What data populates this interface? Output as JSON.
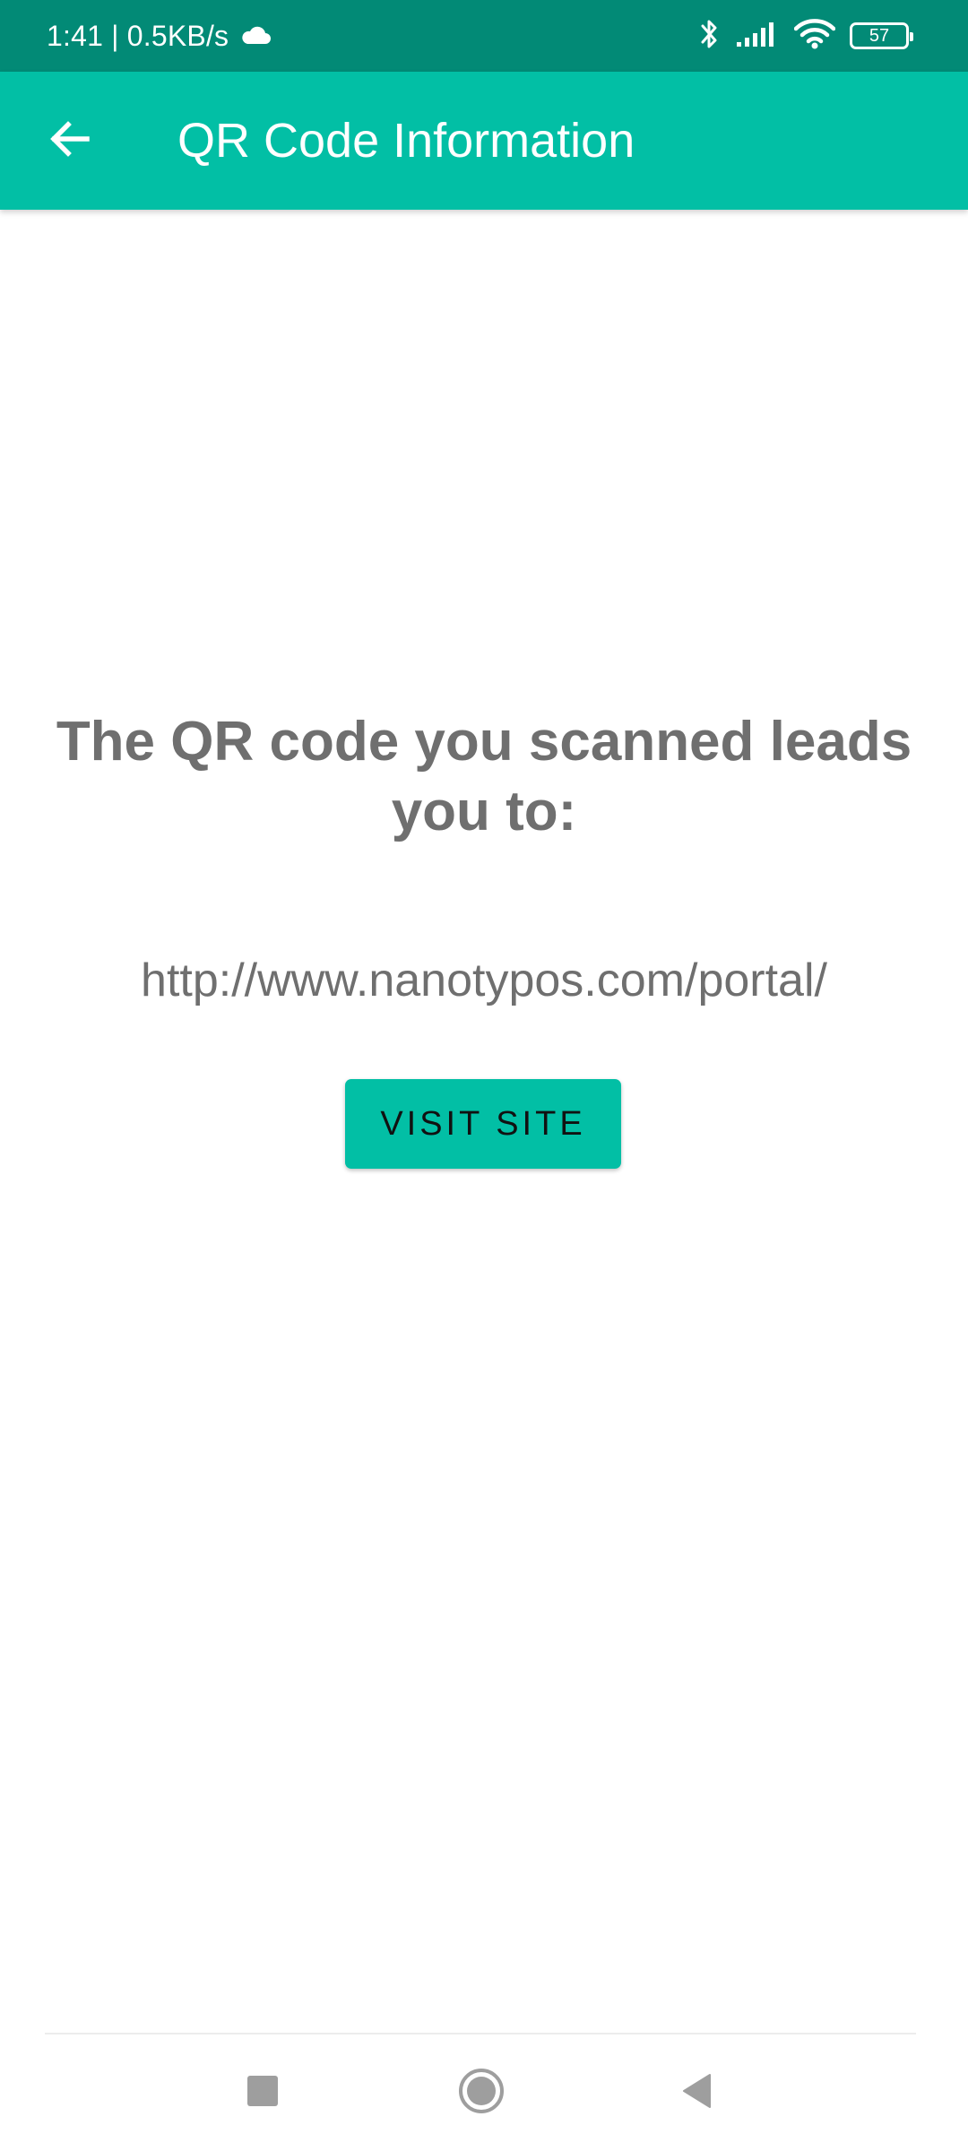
{
  "status_bar": {
    "time_speed": "1:41 | 0.5KB/s",
    "battery_level": "57",
    "icons": [
      "cloud-icon",
      "bluetooth-icon",
      "signal-icon",
      "wifi-icon",
      "battery-icon"
    ]
  },
  "app_bar": {
    "title": "QR Code Information",
    "back_icon": "arrow-back-icon"
  },
  "content": {
    "headline": "The QR code you scanned leads you to:",
    "url": "http://www.nanotypos.com/portal/",
    "visit_button_label": "VISIT SITE"
  },
  "nav_bar": {
    "icons": [
      "recent-apps-icon",
      "home-icon",
      "back-icon"
    ]
  },
  "colors": {
    "status_bar": "#028a76",
    "primary": "#02bfa5",
    "text_gray": "#6f6f6f",
    "nav_icon": "#9e9e9e"
  }
}
